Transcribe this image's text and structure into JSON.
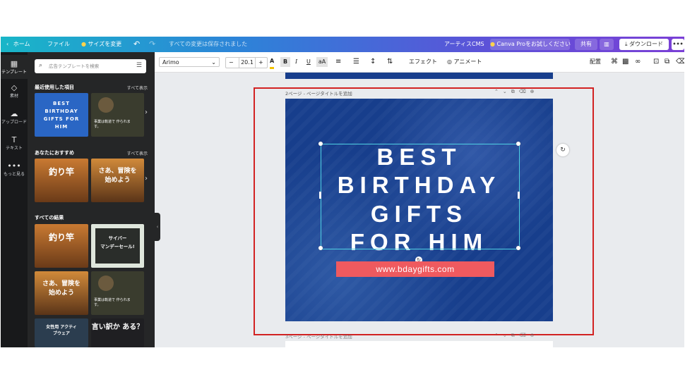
{
  "topbar": {
    "home": "ホーム",
    "file": "ファイル",
    "resize": "サイズを変更",
    "saved": "すべての変更は保存されました",
    "cms": "アーティスCMS",
    "canva_pro": "Canva Proをお試しください",
    "share": "共有",
    "download": "ダウンロード",
    "more": "•••"
  },
  "rail": [
    {
      "label": "テンプレート",
      "icon": "template-icon"
    },
    {
      "label": "素材",
      "icon": "elements-icon"
    },
    {
      "label": "アップロード",
      "icon": "upload-icon"
    },
    {
      "label": "テキスト",
      "icon": "text-icon"
    },
    {
      "label": "もっと見る",
      "icon": "more-icon"
    }
  ],
  "panel": {
    "search_placeholder": "広告テンプレートを検索",
    "recent": "最近使用した項目",
    "recommended": "あなたにおすすめ",
    "all_results": "すべての結果",
    "see_all": "すべて表示",
    "thumbs": {
      "best_birthday": "BEST BIRTHDAY GIFTS FOR HIM",
      "coffee": "事業は軌道で 作られます。",
      "fishing": "釣り竿",
      "adventure": "さあ、冒険を始めよう",
      "cyber_title": "サイバー",
      "cyber_sale": "マンデーセール!",
      "activewear": "女性用 アクティブウェア",
      "excuse": "言い訳か ある？"
    }
  },
  "toolbar": {
    "font": "Arimo",
    "minus": "−",
    "size": "20.1",
    "plus": "+",
    "color_letter": "A",
    "bold": "B",
    "italic": "I",
    "underline": "U",
    "case": "aA",
    "effects": "エフェクト",
    "animate": "アニメート",
    "position": "配置"
  },
  "canvas": {
    "page2_label": "2ページ - ページタイトルを追加",
    "page3_label": "3ページ - ページタイトルを追加",
    "headline": [
      "BEST",
      "BIRTHDAY",
      "GIFTS",
      "FOR HIM"
    ],
    "url": "www.bdaygifts.com"
  },
  "colors": {
    "accent_gradient_start": "#19b6c8",
    "accent_gradient_end": "#7a3fd6",
    "page_bg": "#173e8c",
    "url_bar": "#ef5a5f",
    "highlight": "#d22222"
  }
}
